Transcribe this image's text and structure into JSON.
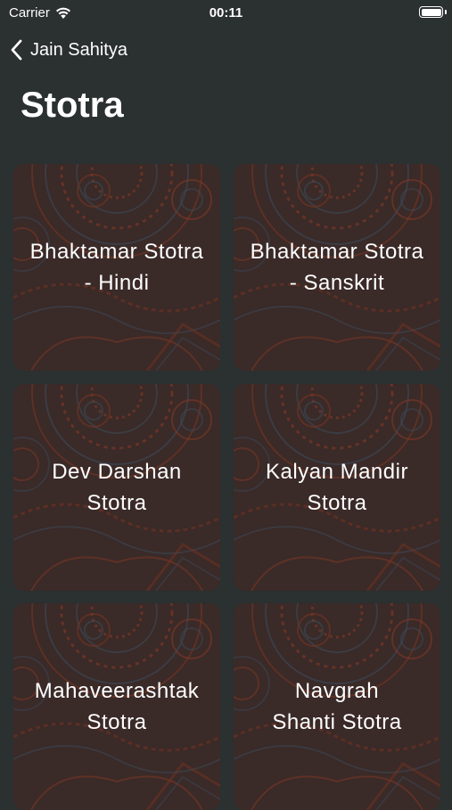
{
  "status_bar": {
    "carrier": "Carrier",
    "time": "00:11",
    "battery_level": 1.0
  },
  "nav": {
    "back_label": "Jain Sahitya"
  },
  "page": {
    "title": "Stotra"
  },
  "colors": {
    "background": "#2b3030",
    "card_base": "#3a2a28",
    "pattern_orange": "#8a3a24",
    "pattern_blue": "#3c4a58",
    "text": "#ffffff"
  },
  "cards": [
    {
      "line1": "Bhaktamar Stotra",
      "line2": "- Hindi"
    },
    {
      "line1": "Bhaktamar Stotra",
      "line2": "- Sanskrit"
    },
    {
      "line1": "Dev Darshan",
      "line2": "Stotra"
    },
    {
      "line1": "Kalyan Mandir",
      "line2": "Stotra"
    },
    {
      "line1": "Mahaveerashtak",
      "line2": "Stotra"
    },
    {
      "line1": "Navgrah",
      "line2": "Shanti Stotra"
    }
  ]
}
